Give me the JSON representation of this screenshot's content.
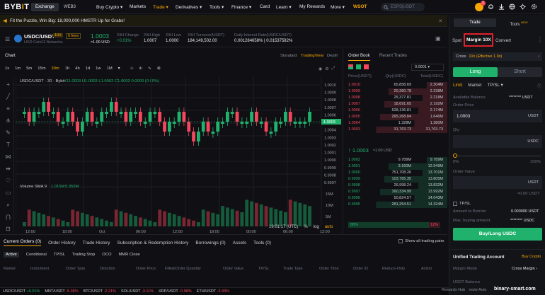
{
  "nav": {
    "logo_a": "BYB",
    "logo_b": "I",
    "logo_c": "T",
    "exchange": "Exchange",
    "web3": "WEB3",
    "items": [
      "Buy Crypto ▾",
      "Markets",
      "Trade ▾",
      "Derivatives ▾",
      "Tools ▾",
      "Finance ▾",
      "Card",
      "Learn ▾",
      "My Rewards",
      "More ▾",
      "WSOT"
    ],
    "search_placeholder": "ESPS|USDT",
    "badge": "1"
  },
  "banner": {
    "text": "Fit the Puzzle, Win Big: 18,000,000 HMSTR Up for Grabs!"
  },
  "ticker": {
    "pair": "USDC/USDT",
    "leverage": "10X",
    "fees": "0 fees",
    "sub": "USD Coin",
    "networks": "13 Networks",
    "price": "1.0003",
    "price_usd": "≈1.00 USD",
    "stats": [
      {
        "label": "24H Change",
        "value": "+0.01%"
      },
      {
        "label": "24H High",
        "value": "1.0007"
      },
      {
        "label": "24H Low",
        "value": "1.0000"
      },
      {
        "label": "24H Turnover(USDT)",
        "value": "184,149,502.00"
      },
      {
        "label": "Daily Interest Rate(USDC/USDT)",
        "value": "0.001284658% | 0.01537582%"
      }
    ]
  },
  "chart": {
    "title": "Chart",
    "modes": [
      "Standard",
      "TradingView",
      "Depth"
    ],
    "intervals": [
      "1s",
      "1m",
      "5m",
      "15m",
      "30m",
      "1h",
      "4h",
      "1d",
      "1w",
      "1M"
    ],
    "legend": "USDC/USDT · 30 · Bybit",
    "ohlc": "O1.0003  H1.0003  L1.0002  C1.0003  0.0000 (0.00%)",
    "y_ticks": [
      "1.0010",
      "1.0009",
      "1.0008",
      "1.0007",
      "1.0006",
      "1.0005",
      "1.0004",
      "1.0003",
      "1.0002",
      "1.0001",
      "1.0000",
      "0.9999",
      "0.9998",
      "0.9997"
    ],
    "last_label": "1.0003",
    "volume_label": "Volume SMA 9",
    "volume_values": [
      "1.015M",
      "5.053M"
    ],
    "vol_ticks": [
      "15M",
      "10M",
      "5M"
    ],
    "x_ticks": [
      "12:00",
      "18:00",
      "Oct",
      "06:00",
      "12:00",
      "18:00",
      "00:00",
      "06:00",
      "12:00"
    ],
    "clock": "19:01:17 (UTC)",
    "pct": "%",
    "log": "log",
    "auto": "auto"
  },
  "orderbook": {
    "tabs": [
      "Order Book",
      "Recent Trades"
    ],
    "step": "0.0001",
    "headers": [
      "Price(USDT)",
      "Qty(USDC)",
      "Total(USDC)"
    ],
    "asks": [
      [
        "1.0010",
        "65,858.69",
        "2.304M"
      ],
      [
        "1.0009",
        "20,360.78",
        "2.238M"
      ],
      [
        "1.0008",
        "25,377.81",
        "2.218M"
      ],
      [
        "1.0007",
        "18,691.65",
        "2.192M"
      ],
      [
        "1.0006",
        "528,136.81",
        "2.174M"
      ],
      [
        "1.0005",
        "265,268.84",
        "1.646M"
      ],
      [
        "1.0004",
        "1.328M",
        "1.380M"
      ],
      [
        "1.0003",
        "31,763.73",
        "31,763.73"
      ]
    ],
    "mid_price": "↑ 1.0003",
    "mid_usd": "≈1.00 USD",
    "bids": [
      [
        "1.0002",
        "9.789M",
        "9.789M"
      ],
      [
        "1.0001",
        "3.160M",
        "12.949M"
      ],
      [
        "1.0000",
        "751,708.26",
        "13.701M"
      ],
      [
        "0.9999",
        "103,785.35",
        "13.805M"
      ],
      [
        "0.9998",
        "26,998.24",
        "13.832M"
      ],
      [
        "0.9997",
        "160,334.99",
        "13.992M"
      ],
      [
        "0.9996",
        "50,824.57",
        "14.043M"
      ],
      [
        "0.9995",
        "281,254.51",
        "14.324M"
      ]
    ],
    "buy_pct": "88%",
    "sell_pct": "12%"
  },
  "trade": {
    "tabs": [
      "Trade",
      "Tools"
    ],
    "tools_badge": "NEW",
    "types": [
      "Spot",
      "Margin 10X",
      "Convert"
    ],
    "cross": "Cross",
    "cross_info": "10x (Effective 1.0x)",
    "long": "Long",
    "short": "Short",
    "order_types": [
      "Limit",
      "Market",
      "TP/SL ▾"
    ],
    "available_label": "Available Balance",
    "available_value": "******** USDT",
    "order_price_label": "Order Price",
    "order_price": "1.0003",
    "usdt": "USDT",
    "qty_label": "Qty",
    "usdc": "USDC",
    "pct_min": "0%",
    "pct_max": "100%",
    "order_value_label": "Order Value",
    "approx": "≈0.00 USDT",
    "tpsl": "TP/SL",
    "borrow_label": "Amount to Borrow",
    "borrow_value": "0.000000 USDT",
    "max_label": "Max. buying amount",
    "max_value": "******** USDC",
    "buy_button": "Buy/Long USDC",
    "uta_title": "Unified Trading Account",
    "buy_crypto": "Buy Crypto",
    "margin_mode_label": "Margin Mode",
    "margin_mode_value": "Cross Margin ›",
    "usdt_balance_label": "USDT Balance"
  },
  "orders": {
    "tabs": [
      "Current Orders (0)",
      "Order History",
      "Trade History",
      "Subscription & Redemption History",
      "Borrowings (0)",
      "Assets",
      "Tools (0)"
    ],
    "show_all": "Show all trading pairs",
    "subtabs": [
      "Active",
      "Conditional",
      "TP/SL",
      "Trailing Stop",
      "OCO",
      "MMR Close"
    ],
    "columns": [
      "Market",
      "Instrument",
      "Order Type",
      "Direction",
      "Order Price",
      "Filled/Order Quantity",
      "Order Value",
      "TP/SL",
      "Trade Type",
      "Order Time",
      "Order ID",
      "Reduce-Only",
      "Action"
    ]
  },
  "footer": {
    "tickers": [
      {
        "pair": "USDC/USDT",
        "chg": "+0.01%",
        "up": true
      },
      {
        "pair": "MNT/USDT",
        "chg": "-5.38%",
        "up": false
      },
      {
        "pair": "BTC/USDT",
        "chg": "-2.21%",
        "up": false
      },
      {
        "pair": "SOL/USDT",
        "chg": "-3.11%",
        "up": false
      },
      {
        "pair": "XRP/USDT",
        "chg": "-0.98%",
        "up": false
      },
      {
        "pair": "ETH/USDT",
        "chg": "-3.43%",
        "up": false
      }
    ],
    "rewards": "Rewards Hub",
    "route": "route Auto",
    "watermark": "binary-smart.com"
  },
  "colors": {
    "accent": "#f7a600",
    "up": "#20b26c",
    "down": "#f6465d",
    "highlight": "#e0202a"
  }
}
